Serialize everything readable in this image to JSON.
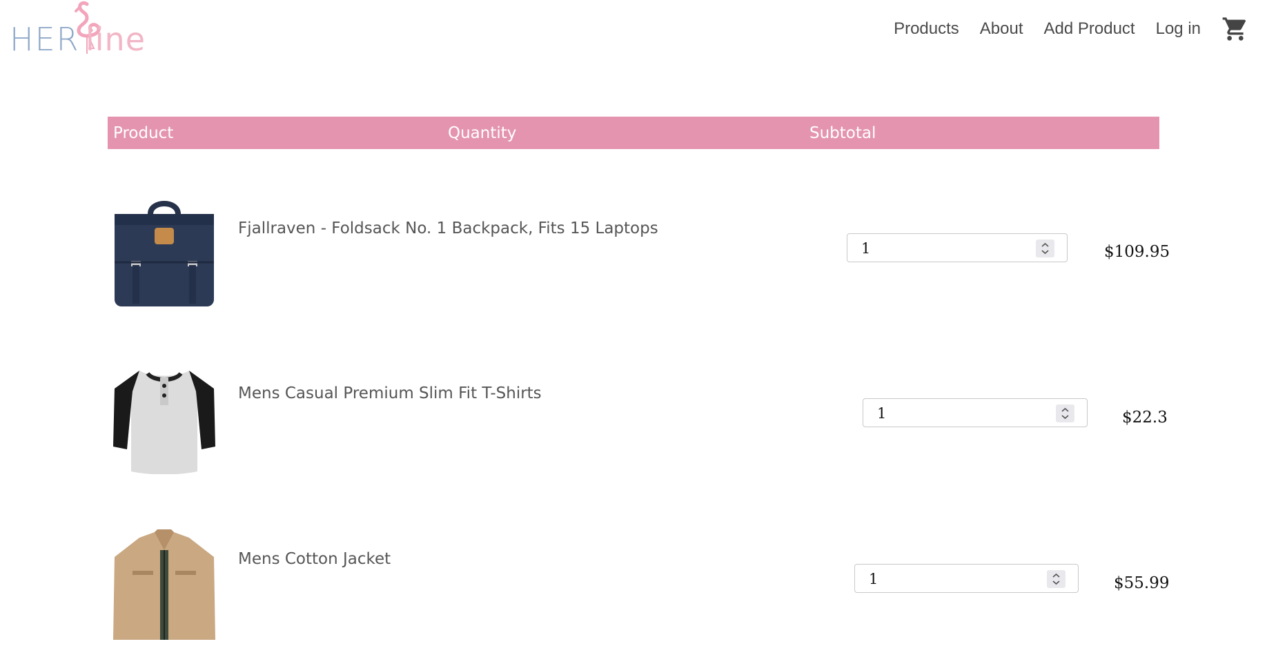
{
  "brand": {
    "logo_her": "HER",
    "logo_line": "line"
  },
  "nav": {
    "items": [
      {
        "label": "Products"
      },
      {
        "label": "About"
      },
      {
        "label": "Add Product"
      },
      {
        "label": "Log in"
      }
    ],
    "cart_icon": "shopping-cart-icon"
  },
  "cart_table": {
    "headers": {
      "product": "Product",
      "quantity": "Quantity",
      "subtotal": "Subtotal"
    },
    "rows": [
      {
        "name": "Fjallraven - Foldsack No. 1 Backpack, Fits 15 Laptops",
        "quantity": "1",
        "subtotal": "$109.95",
        "image_icon": "backpack-image"
      },
      {
        "name": "Mens Casual Premium Slim Fit T-Shirts",
        "quantity": "1",
        "subtotal": "$22.3",
        "image_icon": "tshirt-image"
      },
      {
        "name": "Mens Cotton Jacket",
        "quantity": "1",
        "subtotal": "$55.99",
        "image_icon": "jacket-image"
      }
    ]
  },
  "colors": {
    "header_bg": "#e494ae",
    "logo_blue": "#8fa8c8",
    "logo_pink": "#f2b6c6"
  }
}
